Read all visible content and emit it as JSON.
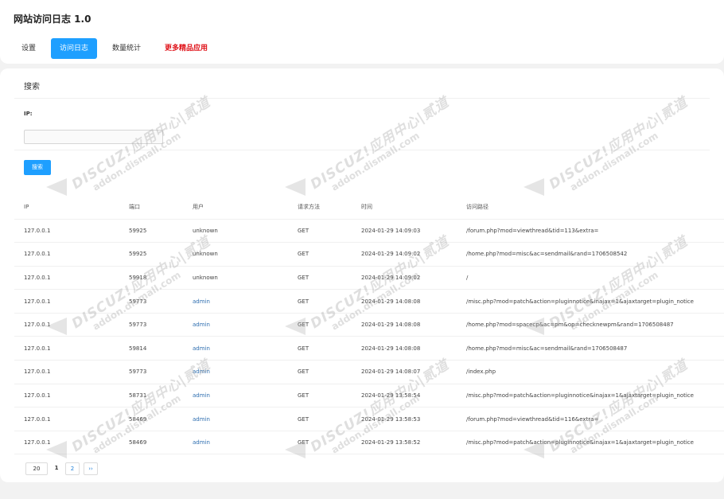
{
  "app": {
    "title": "网站访问日志 1.0"
  },
  "nav": {
    "tabs": [
      {
        "label": "设置"
      },
      {
        "label": "访问日志"
      },
      {
        "label": "数量统计"
      },
      {
        "label": "更多精品应用"
      }
    ],
    "active_tab": "访问日志"
  },
  "search": {
    "title": "搜索",
    "ip_label": "IP:",
    "ip_value": "",
    "button_label": "搜索"
  },
  "table": {
    "headers": [
      "IP",
      "端口",
      "用户",
      "请求方法",
      "时间",
      "访问路径"
    ],
    "rows": [
      [
        "127.0.0.1",
        "59925",
        "unknown",
        "GET",
        "2024-01-29 14:09:03",
        "/forum.php?mod=viewthread&tid=113&extra="
      ],
      [
        "127.0.0.1",
        "59925",
        "unknown",
        "GET",
        "2024-01-29 14:09:02",
        "/home.php?mod=misc&ac=sendmail&rand=1706508542"
      ],
      [
        "127.0.0.1",
        "59918",
        "unknown",
        "GET",
        "2024-01-29 14:09:02",
        "/"
      ],
      [
        "127.0.0.1",
        "59773",
        "admin",
        "GET",
        "2024-01-29 14:08:08",
        "/misc.php?mod=patch&action=pluginnotice&inajax=1&ajaxtarget=plugin_notice"
      ],
      [
        "127.0.0.1",
        "59773",
        "admin",
        "GET",
        "2024-01-29 14:08:08",
        "/home.php?mod=spacecp&ac=pm&op=checknewpm&rand=1706508487"
      ],
      [
        "127.0.0.1",
        "59814",
        "admin",
        "GET",
        "2024-01-29 14:08:08",
        "/home.php?mod=misc&ac=sendmail&rand=1706508487"
      ],
      [
        "127.0.0.1",
        "59773",
        "admin",
        "GET",
        "2024-01-29 14:08:07",
        "/index.php"
      ],
      [
        "127.0.0.1",
        "58731",
        "admin",
        "GET",
        "2024-01-29 13:58:54",
        "/misc.php?mod=patch&action=pluginnotice&inajax=1&ajaxtarget=plugin_notice"
      ],
      [
        "127.0.0.1",
        "58469",
        "admin",
        "GET",
        "2024-01-29 13:58:53",
        "/forum.php?mod=viewthread&tid=116&extra="
      ],
      [
        "127.0.0.1",
        "58469",
        "admin",
        "GET",
        "2024-01-29 13:58:52",
        "/misc.php?mod=patch&action=pluginnotice&inajax=1&ajaxtarget=plugin_notice"
      ]
    ]
  },
  "pagination": {
    "page_size": "20",
    "current_page": "1",
    "next_page": "2",
    "next_label": "››"
  },
  "watermark": {
    "main": "DISCUZ!应用中心|贰道",
    "sub": "addon.dismall.com"
  },
  "colors": {
    "accent": "#1e9fff",
    "promo": "#e0161d",
    "user_link": "#2f6fb0",
    "background": "#f2f2f2"
  }
}
